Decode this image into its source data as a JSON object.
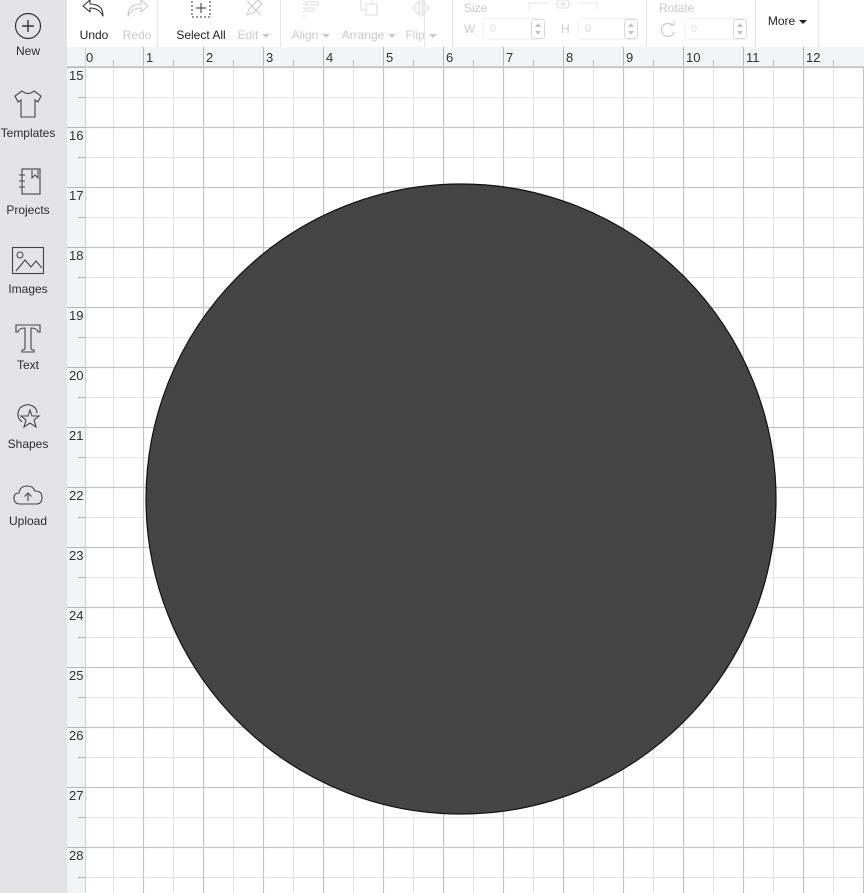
{
  "sidebar": {
    "items": [
      {
        "label": "New",
        "icon": "plus-circle-icon"
      },
      {
        "label": "Templates",
        "icon": "tshirt-icon"
      },
      {
        "label": "Projects",
        "icon": "notebook-icon"
      },
      {
        "label": "Images",
        "icon": "image-icon"
      },
      {
        "label": "Text",
        "icon": "text-t-icon"
      },
      {
        "label": "Shapes",
        "icon": "shapes-icon"
      },
      {
        "label": "Upload",
        "icon": "cloud-upload-icon"
      }
    ]
  },
  "toolbar": {
    "undo_label": "Undo",
    "redo_label": "Redo",
    "select_all_label": "Select All",
    "edit_label": "Edit",
    "align_label": "Align",
    "arrange_label": "Arrange",
    "flip_label": "Flip",
    "size_title": "Size",
    "width_label": "W",
    "width_value": "0",
    "height_label": "H",
    "height_value": "0",
    "rotate_title": "Rotate",
    "rotate_value": "0",
    "more_label": "More"
  },
  "rulers": {
    "top_labels": [
      "0",
      "1",
      "2",
      "3",
      "4",
      "5",
      "6",
      "7",
      "8",
      "9",
      "10",
      "11",
      "12"
    ],
    "left_labels": [
      "15",
      "16",
      "17",
      "18",
      "19",
      "20",
      "21",
      "22",
      "23",
      "24",
      "25",
      "26",
      "27",
      "28"
    ]
  },
  "canvas": {
    "shape": {
      "type": "circle",
      "fill": "#454545",
      "stroke": "#111111",
      "center_in": [
        6.3,
        22.2
      ],
      "diameter_in": 10.5
    }
  }
}
